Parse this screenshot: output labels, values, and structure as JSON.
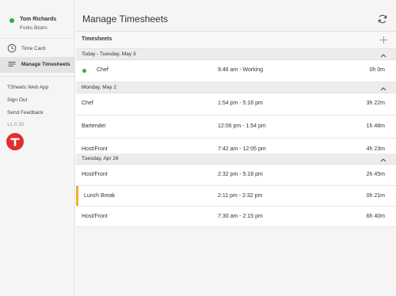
{
  "user": {
    "name": "Tom Richards",
    "company": "Forks Bistro",
    "status_color": "#2eae4b"
  },
  "nav": [
    {
      "label": "Time Card",
      "icon": "clock-icon",
      "active": false
    },
    {
      "label": "Manage Timesheets",
      "icon": "list-icon",
      "active": true
    }
  ],
  "links": {
    "web_app": "TSheets Web App",
    "sign_out": "Sign Out",
    "send_feedback": "Send Feedback"
  },
  "version": "v1.0.35",
  "logo": {
    "letter": "T",
    "color": "#e42d2d"
  },
  "header": {
    "title": "Manage Timesheets",
    "refresh_icon": "refresh-icon"
  },
  "timesheets": {
    "title": "Timesheets",
    "add_icon": "plus-icon",
    "groups": [
      {
        "label": "Today - Tuesday, May 3",
        "rows": [
          {
            "job": "Chef",
            "time": "9:46 am - Working",
            "hours": "0h",
            "minutes": "0m",
            "working": true
          }
        ]
      },
      {
        "label": "Monday, May 2",
        "rows": [
          {
            "job": "Chef",
            "time": "1:54 pm - 5:16 pm",
            "hours": "3h",
            "minutes": "22m"
          },
          {
            "job": "Bartender",
            "time": "12:06 pm - 1:54 pm",
            "hours": "1h",
            "minutes": "48m"
          },
          {
            "job": "Host/Front",
            "time": "7:42 am - 12:05 pm",
            "hours": "4h",
            "minutes": "23m"
          }
        ]
      },
      {
        "label": "Tuesday, Apr 26",
        "rows": [
          {
            "job": "Host/Front",
            "time": "2:32 pm - 5:18 pm",
            "hours": "2h",
            "minutes": "45m"
          },
          {
            "job": "Lunch Break",
            "time": "2:11 pm - 2:32 pm",
            "hours": "0h",
            "minutes": "21m",
            "break": true
          },
          {
            "job": "Host/Front",
            "time": "7:30 am - 2:15 pm",
            "hours": "6h",
            "minutes": "40m"
          }
        ]
      }
    ]
  },
  "colors": {
    "working": "#2eae4b",
    "break": "#f1b02b",
    "brand": "#e42d2d"
  }
}
